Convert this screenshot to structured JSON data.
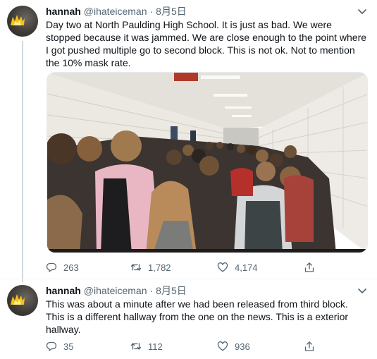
{
  "tweets": [
    {
      "name": "hannah",
      "handle": "@ihateiceman",
      "dot": "·",
      "date": "8月5日",
      "text": "Day two at North Paulding High School. It is just as bad. We were stopped because it was jammed. We are close enough to the point where I got pushed multiple go to second block. This is not ok. Not to mention the 10% mask rate.",
      "replies": "263",
      "retweets": "1,782",
      "likes": "4,174"
    },
    {
      "name": "hannah",
      "handle": "@ihateiceman",
      "dot": "·",
      "date": "8月5日",
      "text": "This was about a minute after we had been released from third block. This is a different hallway from the one on the news. This is a exterior hallway.",
      "replies": "35",
      "retweets": "112",
      "likes": "936"
    }
  ],
  "icons": {
    "more": "chevron-down-icon",
    "reply": "reply-icon",
    "retweet": "retweet-icon",
    "like": "heart-icon",
    "share": "share-icon"
  },
  "colors": {
    "text": "#0f1419",
    "secondary": "#536471",
    "thread_line": "#cfd9de"
  }
}
